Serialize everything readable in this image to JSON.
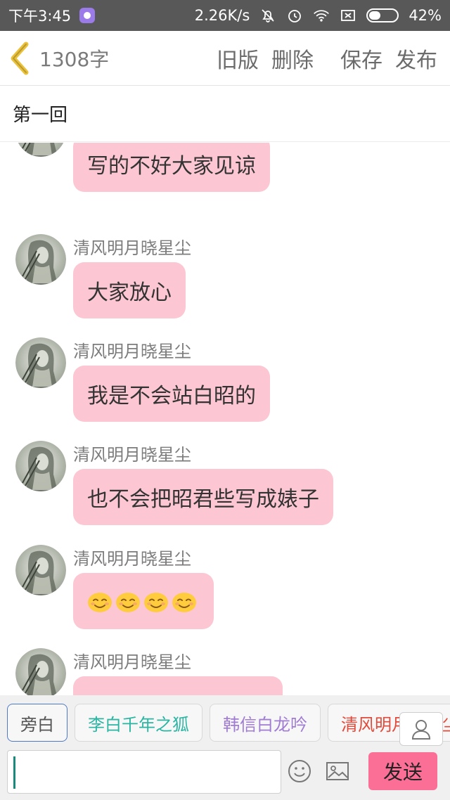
{
  "status_bar": {
    "time": "下午3:45",
    "net_speed": "2.26K/s",
    "battery_percent": "42%",
    "battery_level": 0.42,
    "icons": [
      "app-notification-icon",
      "mute-bell-icon",
      "alarm-icon",
      "wifi-icon",
      "sim-off-icon",
      "battery-icon"
    ]
  },
  "toolbar": {
    "word_count": "1308字",
    "old_version": "旧版",
    "delete": "删除",
    "save": "保存",
    "publish": "发布",
    "accent": "#e9c13b"
  },
  "chapter_title": "第一回",
  "messages": [
    {
      "name": "",
      "text": "写的不好大家见谅"
    },
    {
      "name": "清风明月晓星尘",
      "text": "大家放心"
    },
    {
      "name": "清风明月晓星尘",
      "text": "我是不会站白昭的"
    },
    {
      "name": "清风明月晓星尘",
      "text": "也不会把昭君些写成婊子"
    },
    {
      "name": "清风明月晓星尘",
      "emoji_count": 4,
      "emoji": "smiling-face-icon"
    },
    {
      "name": "清风明月晓星尘",
      "text": ""
    }
  ],
  "roles": [
    {
      "label": "旁白",
      "color": "#555555"
    },
    {
      "label": "李白千年之狐",
      "color": "#2bb5a3"
    },
    {
      "label": "韩信白龙吟",
      "color": "#a07cd3"
    },
    {
      "label": "清风明月晓星尘",
      "color": "#e24a3b"
    }
  ],
  "input": {
    "value": "",
    "send_label": "发送",
    "send_color": "#fb6f97"
  },
  "colors": {
    "bubble": "#fcc6d2",
    "statusbar": "#585858"
  }
}
